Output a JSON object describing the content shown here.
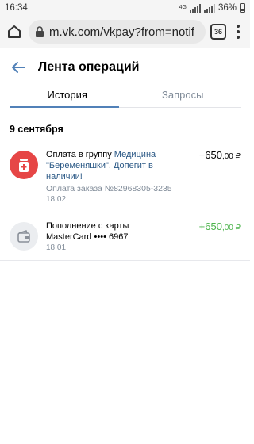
{
  "status": {
    "time": "16:34",
    "network": "4G",
    "battery": "36%"
  },
  "browser": {
    "url": "m.vk.com/vkpay?from=notif",
    "tab_count": "36"
  },
  "page": {
    "title": "Лента операций",
    "tabs": [
      "История",
      "Запросы"
    ]
  },
  "date_header": "9 сентября",
  "operations": [
    {
      "line1": "Оплата в группу ",
      "link": "Медицина \"Беременяшки\". Допегит в наличии!",
      "sub": "Оплата заказа №82968305-3235",
      "time": "18:02",
      "amount_main": "−650",
      "amount_kop": ",00 ₽",
      "icon": "medicine-icon"
    },
    {
      "line1": "Пополнение с карты MasterCard •••• 6967",
      "time": "18:01",
      "amount_main": "+650",
      "amount_kop": ",00 ₽",
      "icon": "wallet-icon"
    }
  ],
  "colors": {
    "accent": "#5181b8",
    "negative_amount": "#000000",
    "positive_amount": "#4bb34b",
    "group_icon_bg": "#e64646"
  }
}
